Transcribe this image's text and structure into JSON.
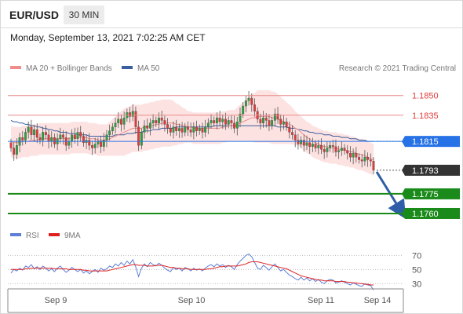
{
  "header": {
    "symbol": "EUR/USD",
    "timeframe": "30 MIN"
  },
  "timestamp": "Monday, September 13, 2021 7:02:25 AM CET",
  "copyright": "Research © 2021 Trading Central",
  "legend": {
    "price": [
      {
        "label": "MA 20 + Bollinger Bands",
        "color": "#f08c8c"
      },
      {
        "label": "MA 50",
        "color": "#3a5f9e"
      }
    ],
    "rsi": [
      {
        "label": "RSI",
        "color": "#5b7fd6"
      },
      {
        "label": "9MA",
        "color": "#e02020"
      }
    ]
  },
  "colors": {
    "up_candle": "#2e9e3e",
    "down_candle": "#e03a3a",
    "bollinger_fill": "#fde2e2",
    "support": "#1a8a1a",
    "pivot": "#2672e6",
    "current": "#333333",
    "arrow": "#2f5ea8"
  },
  "chart_data": [
    {
      "type": "candlestick",
      "ylim": [
        1.1754,
        1.1863
      ],
      "x_ticks": [
        "Sep 9",
        "Sep 10",
        "Sep 11",
        "Sep 14"
      ],
      "levels": [
        {
          "value": 1.185,
          "label": "1.1850",
          "kind": "resistance"
        },
        {
          "value": 1.1835,
          "label": "1.1835",
          "kind": "resistance"
        },
        {
          "value": 1.1815,
          "label": "1.1815",
          "kind": "pivot"
        },
        {
          "value": 1.1793,
          "label": "1.1793",
          "kind": "current"
        },
        {
          "value": 1.1775,
          "label": "1.1775",
          "kind": "support"
        },
        {
          "value": 1.176,
          "label": "1.1760",
          "kind": "support"
        }
      ],
      "close": [
        1.181,
        1.1805,
        1.1812,
        1.1818,
        1.1816,
        1.1822,
        1.1826,
        1.182,
        1.1824,
        1.1818,
        1.1816,
        1.1822,
        1.182,
        1.1815,
        1.1818,
        1.1813,
        1.1817,
        1.182,
        1.1818,
        1.1812,
        1.1815,
        1.182,
        1.1817,
        1.1822,
        1.1819,
        1.1814,
        1.1816,
        1.1812,
        1.181,
        1.1813,
        1.1815,
        1.1811,
        1.1816,
        1.182,
        1.1823,
        1.1826,
        1.1829,
        1.1832,
        1.1828,
        1.1833,
        1.1837,
        1.1834,
        1.1838,
        1.1826,
        1.1812,
        1.1822,
        1.1827,
        1.1825,
        1.1829,
        1.1831,
        1.1829,
        1.1833,
        1.1831,
        1.1828,
        1.1825,
        1.1822,
        1.1826,
        1.1823,
        1.1825,
        1.1822,
        1.1826,
        1.1824,
        1.1822,
        1.1826,
        1.1823,
        1.1825,
        1.1822,
        1.1826,
        1.1829,
        1.1831,
        1.1829,
        1.1833,
        1.183,
        1.1832,
        1.1828,
        1.1831,
        1.1829,
        1.1825,
        1.183,
        1.1836,
        1.1842,
        1.1846,
        1.1848,
        1.1843,
        1.1838,
        1.1832,
        1.1829,
        1.1833,
        1.1831,
        1.1827,
        1.1831,
        1.1836,
        1.1832,
        1.1828,
        1.183,
        1.1826,
        1.1822,
        1.182,
        1.1816,
        1.1813,
        1.1816,
        1.1812,
        1.1814,
        1.1811,
        1.1813,
        1.181,
        1.1812,
        1.1809,
        1.1807,
        1.181,
        1.1812,
        1.1811,
        1.1807,
        1.1808,
        1.181,
        1.1808,
        1.1806,
        1.1803,
        1.1806,
        1.1803,
        1.1801,
        1.18,
        1.1803,
        1.1801,
        1.18,
        1.1793
      ],
      "ma20": [
        1.1815,
        1.1814,
        1.1814,
        1.1814,
        1.1815,
        1.1815,
        1.1815,
        1.1816,
        1.1816,
        1.1816,
        1.1817,
        1.1817,
        1.1817,
        1.1817,
        1.1817,
        1.1817,
        1.1817,
        1.1817,
        1.1817,
        1.1817,
        1.1817,
        1.1818,
        1.1818,
        1.1818,
        1.1818,
        1.1818,
        1.1818,
        1.1817,
        1.1817,
        1.1817,
        1.1816,
        1.1816,
        1.1816,
        1.1816,
        1.1817,
        1.1818,
        1.1819,
        1.182,
        1.1821,
        1.1822,
        1.1823,
        1.1824,
        1.1825,
        1.1825,
        1.1825,
        1.1825,
        1.1826,
        1.1826,
        1.1827,
        1.1827,
        1.1828,
        1.1828,
        1.1829,
        1.1829,
        1.1829,
        1.1829,
        1.1829,
        1.1828,
        1.1828,
        1.1827,
        1.1827,
        1.1826,
        1.1826,
        1.1825,
        1.1825,
        1.1825,
        1.1825,
        1.1825,
        1.1825,
        1.1825,
        1.1825,
        1.1825,
        1.1825,
        1.1826,
        1.1826,
        1.1827,
        1.1827,
        1.1827,
        1.1828,
        1.1829,
        1.183,
        1.1831,
        1.1832,
        1.1833,
        1.1833,
        1.1834,
        1.1834,
        1.1834,
        1.1834,
        1.1834,
        1.1833,
        1.1833,
        1.1832,
        1.1831,
        1.183,
        1.1829,
        1.1828,
        1.1827,
        1.1825,
        1.1824,
        1.1822,
        1.182,
        1.1818,
        1.1817,
        1.1815,
        1.1814,
        1.1813,
        1.1812,
        1.1811,
        1.1811,
        1.181,
        1.181,
        1.181,
        1.1809,
        1.1809,
        1.1808,
        1.1808,
        1.1807,
        1.1807,
        1.1806,
        1.1805,
        1.1805,
        1.1804,
        1.1803,
        1.1802,
        1.1801
      ],
      "ma50": [
        1.1831,
        1.183,
        1.183,
        1.1829,
        1.1829,
        1.1828,
        1.1828,
        1.1827,
        1.1827,
        1.1826,
        1.1826,
        1.1825,
        1.1825,
        1.1824,
        1.1824,
        1.1823,
        1.1823,
        1.1822,
        1.1822,
        1.1822,
        1.1821,
        1.1821,
        1.1821,
        1.182,
        1.182,
        1.182,
        1.182,
        1.1819,
        1.1819,
        1.1819,
        1.1819,
        1.1819,
        1.1819,
        1.1819,
        1.1819,
        1.1819,
        1.182,
        1.182,
        1.182,
        1.182,
        1.1821,
        1.1821,
        1.1821,
        1.1822,
        1.1822,
        1.1822,
        1.1823,
        1.1823,
        1.1823,
        1.1824,
        1.1824,
        1.1824,
        1.1825,
        1.1825,
        1.1825,
        1.1825,
        1.1825,
        1.1826,
        1.1826,
        1.1826,
        1.1826,
        1.1826,
        1.1826,
        1.1826,
        1.1826,
        1.1826,
        1.1826,
        1.1826,
        1.1826,
        1.1826,
        1.1827,
        1.1827,
        1.1827,
        1.1827,
        1.1827,
        1.1827,
        1.1827,
        1.1827,
        1.1827,
        1.1827,
        1.1827,
        1.1827,
        1.1827,
        1.1827,
        1.1827,
        1.1827,
        1.1827,
        1.1827,
        1.1827,
        1.1827,
        1.1827,
        1.1827,
        1.1826,
        1.1826,
        1.1826,
        1.1826,
        1.1825,
        1.1825,
        1.1825,
        1.1824,
        1.1824,
        1.1823,
        1.1823,
        1.1822,
        1.1822,
        1.1821,
        1.1821,
        1.1821,
        1.182,
        1.182,
        1.182,
        1.1819,
        1.1819,
        1.1819,
        1.1818,
        1.1818,
        1.1818,
        1.1817,
        1.1817,
        1.1817,
        1.1816,
        1.1816,
        1.1816,
        1.1815,
        1.1815,
        1.1815
      ],
      "bb_width": [
        0.0012,
        0.0012,
        0.0012,
        0.0012,
        0.0012,
        0.0012,
        0.0012,
        0.0012,
        0.0012,
        0.0012,
        0.0012,
        0.0012,
        0.0012,
        0.0012,
        0.0012,
        0.0012,
        0.0012,
        0.0012,
        0.0012,
        0.0012,
        0.0012,
        0.0012,
        0.0012,
        0.0012,
        0.0012,
        0.0012,
        0.0012,
        0.0012,
        0.0012,
        0.0012,
        0.0012,
        0.0012,
        0.0012,
        0.0012,
        0.0013,
        0.0014,
        0.0015,
        0.0016,
        0.0017,
        0.0018,
        0.0018,
        0.0018,
        0.0018,
        0.0018,
        0.0018,
        0.0018,
        0.0018,
        0.0018,
        0.0018,
        0.0018,
        0.0018,
        0.0018,
        0.0018,
        0.0018,
        0.0018,
        0.0018,
        0.0017,
        0.0016,
        0.0015,
        0.0014,
        0.0013,
        0.0012,
        0.0012,
        0.0012,
        0.0012,
        0.0012,
        0.0012,
        0.0012,
        0.0012,
        0.0012,
        0.0012,
        0.0012,
        0.0012,
        0.0012,
        0.0012,
        0.0012,
        0.0012,
        0.0012,
        0.0013,
        0.0014,
        0.0015,
        0.0016,
        0.0017,
        0.0018,
        0.0019,
        0.002,
        0.002,
        0.002,
        0.002,
        0.002,
        0.002,
        0.002,
        0.0019,
        0.0018,
        0.0017,
        0.0016,
        0.0015,
        0.0014,
        0.0013,
        0.0012,
        0.0012,
        0.0012,
        0.0012,
        0.0012,
        0.0012,
        0.0012,
        0.0012,
        0.0012,
        0.0012,
        0.0012,
        0.0012,
        0.0012,
        0.0012,
        0.0012,
        0.0012,
        0.0012,
        0.0012,
        0.0012,
        0.0012,
        0.0012,
        0.0012,
        0.0012,
        0.0012,
        0.0012,
        0.0012,
        0.0012
      ],
      "forecast_target": 1.176
    },
    {
      "type": "line",
      "title": "RSI",
      "y_ticks": [
        70,
        50,
        30
      ],
      "ylim": [
        18,
        85
      ],
      "rsi": [
        45,
        50,
        48,
        52,
        49,
        55,
        53,
        57,
        51,
        54,
        50,
        55,
        52,
        48,
        51,
        47,
        52,
        55,
        50,
        46,
        49,
        53,
        50,
        47,
        50,
        45,
        48,
        44,
        47,
        50,
        46,
        52,
        49,
        51,
        55,
        53,
        58,
        55,
        60,
        56,
        62,
        58,
        64,
        54,
        40,
        52,
        58,
        54,
        60,
        57,
        55,
        59,
        56,
        52,
        49,
        47,
        53,
        50,
        52,
        48,
        53,
        51,
        48,
        52,
        49,
        51,
        48,
        52,
        55,
        57,
        54,
        58,
        55,
        57,
        53,
        56,
        54,
        50,
        57,
        62,
        66,
        70,
        72,
        68,
        60,
        52,
        50,
        56,
        53,
        49,
        54,
        58,
        53,
        48,
        50,
        46,
        42,
        40,
        37,
        35,
        39,
        35,
        38,
        34,
        37,
        33,
        36,
        32,
        30,
        34,
        36,
        35,
        31,
        32,
        34,
        32,
        30,
        28,
        31,
        29,
        27,
        26,
        30,
        28,
        27,
        21
      ],
      "ma9": [
        50,
        50,
        50,
        50,
        50,
        51,
        51,
        52,
        52,
        52,
        52,
        52,
        52,
        52,
        52,
        51,
        51,
        51,
        51,
        51,
        50,
        50,
        50,
        50,
        50,
        49,
        49,
        48,
        48,
        48,
        48,
        48,
        48,
        48,
        49,
        50,
        51,
        52,
        53,
        54,
        55,
        56,
        57,
        57,
        56,
        56,
        56,
        55,
        55,
        55,
        56,
        56,
        56,
        55,
        54,
        53,
        53,
        52,
        52,
        51,
        51,
        51,
        50,
        50,
        50,
        50,
        50,
        50,
        51,
        51,
        52,
        53,
        54,
        54,
        55,
        55,
        55,
        55,
        55,
        56,
        57,
        58,
        60,
        61,
        61,
        61,
        60,
        59,
        58,
        57,
        56,
        55,
        54,
        53,
        52,
        51,
        49,
        47,
        45,
        43,
        41,
        40,
        39,
        38,
        37,
        36,
        35,
        35,
        34,
        34,
        34,
        34,
        33,
        33,
        33,
        33,
        32,
        32,
        31,
        31,
        30,
        30,
        29,
        29,
        28,
        28
      ]
    }
  ]
}
